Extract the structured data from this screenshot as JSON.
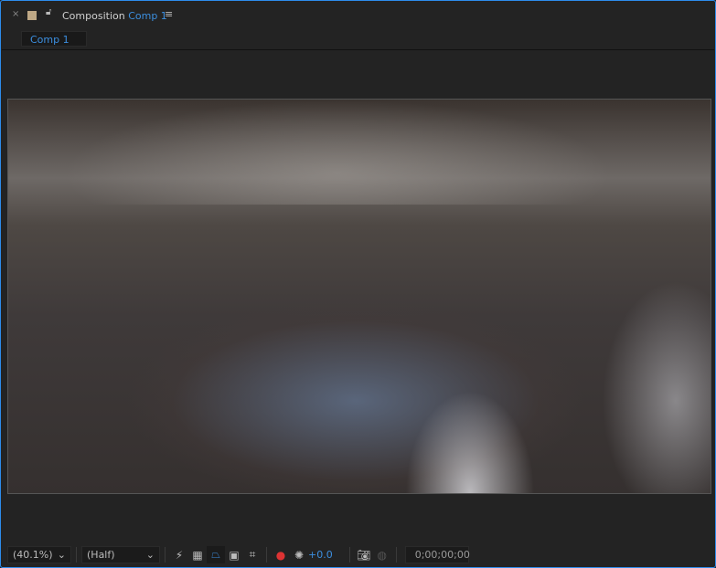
{
  "panel": {
    "close": "×",
    "title": "Composition",
    "comp_name": "Comp 1",
    "menu": "≡"
  },
  "tabs": [
    {
      "label": "Comp 1",
      "active": true
    }
  ],
  "toolbar": {
    "zoom": "(40.1%)",
    "resolution": "(Half)",
    "exposure": "+0.0",
    "timecode": "0;00;00;00",
    "icons": [
      "fast-previews-icon",
      "transparency-grid-icon",
      "mask-visibility-icon",
      "region-of-interest-icon",
      "guides-grid-icon",
      "color-channels-icon",
      "reset-exposure-icon",
      "snapshot-icon",
      "show-snapshot-icon"
    ]
  },
  "colors": {
    "accent": "#2d8ceb",
    "label": "#bfa885"
  }
}
